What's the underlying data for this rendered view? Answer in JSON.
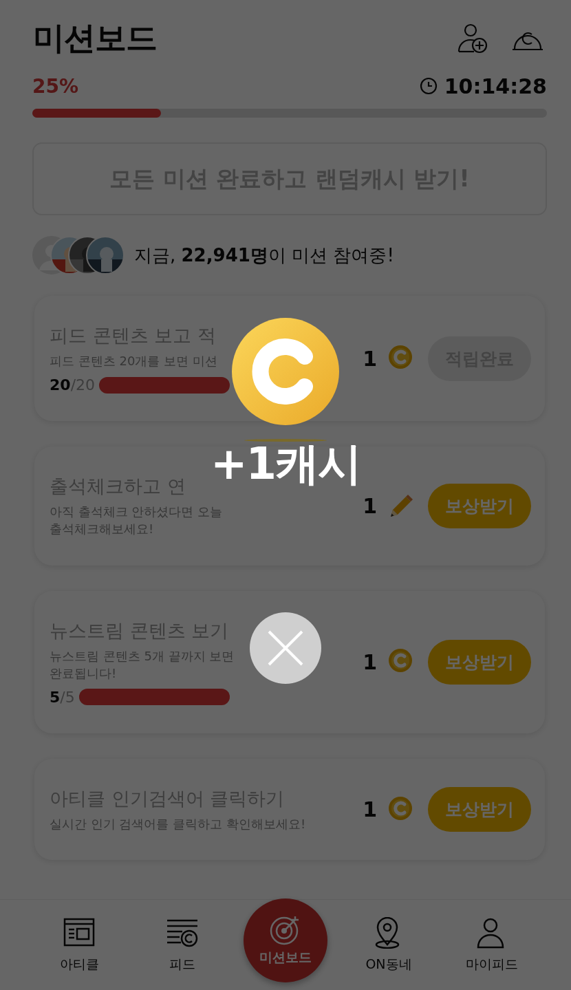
{
  "header": {
    "title": "미션보드"
  },
  "progress": {
    "percent": "25%",
    "timer": "10:14:28",
    "level": 0.25
  },
  "banner": {
    "label": "모든 미션 완료하고 랜덤캐시 받기!"
  },
  "participants": {
    "avatars": [
      {
        "kind": "placeholder"
      },
      {
        "kind": "picture"
      },
      {
        "kind": "picture"
      },
      {
        "kind": "picture"
      }
    ],
    "text": "지금, **22,941명**이 미션 참여중!"
  },
  "missions": [
    {
      "title": "피드 콘텐츠 보고 적",
      "lines": [
        "피드 콘텐츠 20개를 보면 미션"
      ],
      "progress": "**20**/20",
      "level": 1,
      "reward": "1",
      "kind": "coin",
      "button": "적립완료",
      "done": true
    },
    {
      "title": "출석체크하고 연",
      "lines": [
        "아직 출석체크 안하셨다면 오늘",
        "출석체크해보세요!"
      ],
      "reward": "1",
      "kind": "pencil",
      "button": "보상받기",
      "done": false
    },
    {
      "title": "뉴스트림 콘텐츠 보기",
      "lines": [
        "뉴스트림 콘텐츠 5개 끝까지 보면",
        "완료됩니다!"
      ],
      "progress": "**5**/5",
      "level": 1,
      "reward": "1",
      "kind": "coin",
      "button": "보상받기",
      "done": false
    },
    {
      "title": "아티클 인기검색어 클릭하기",
      "lines": [
        "실시간 인기 검색어를 클릭하고 확인해보세요!"
      ],
      "reward": "1",
      "kind": "coin",
      "button": "보상받기",
      "done": false
    }
  ],
  "nav": [
    {
      "label": "아티클",
      "kind": "article",
      "selected": false
    },
    {
      "label": "피드",
      "kind": "feed",
      "selected": false
    },
    {
      "label": "미션보드",
      "kind": "target",
      "selected": true
    },
    {
      "label": "ON동네",
      "kind": "pin",
      "selected": false
    },
    {
      "label": "마이피드",
      "kind": "person",
      "selected": false
    }
  ],
  "modal": {
    "reward_text": "+1캐시"
  }
}
